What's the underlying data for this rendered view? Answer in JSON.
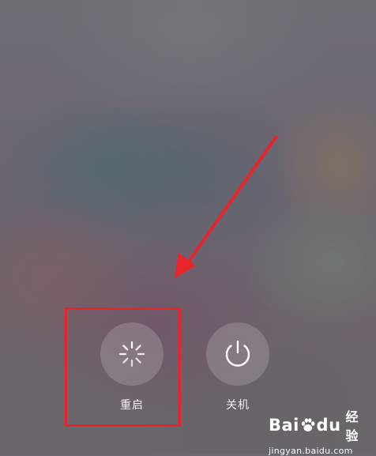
{
  "power_menu": {
    "restart": {
      "label": "重启",
      "icon": "restart-spinner-icon"
    },
    "shutdown": {
      "label": "关机",
      "icon": "power-icon"
    }
  },
  "annotation": {
    "arrow_color": "#e8232a",
    "highlight_color": "#e8232a"
  },
  "watermark": {
    "brand_part1": "Bai",
    "brand_part2": "du",
    "brand_sub": "经验",
    "url": "jingyan.baidu.com"
  }
}
